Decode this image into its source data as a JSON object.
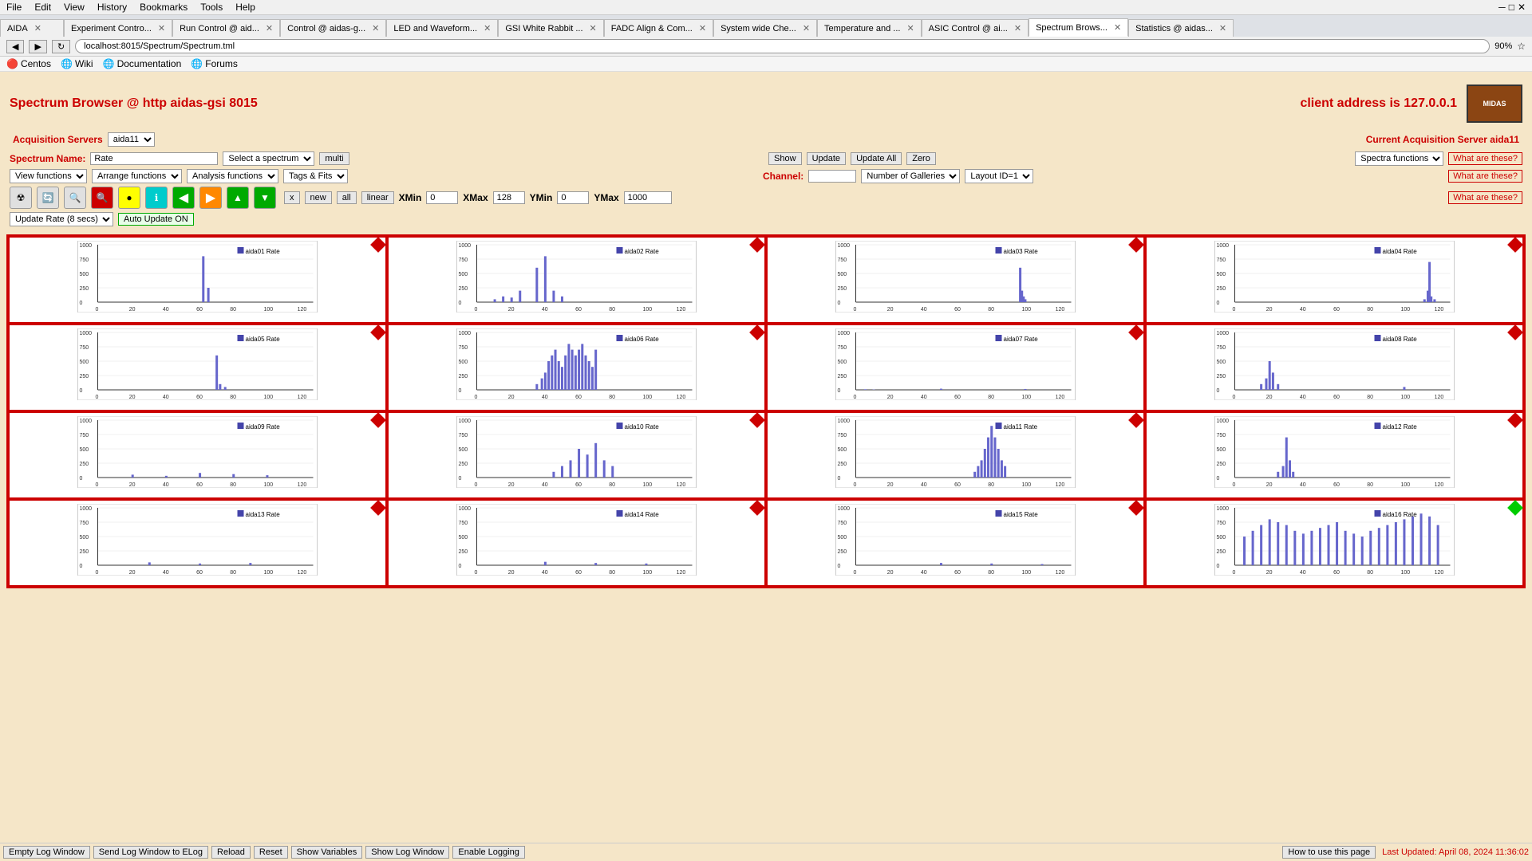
{
  "browser": {
    "menu_items": [
      "File",
      "Edit",
      "View",
      "History",
      "Bookmarks",
      "Tools",
      "Help"
    ],
    "tabs": [
      {
        "label": "AIDA",
        "active": false
      },
      {
        "label": "Experiment Contro...",
        "active": false
      },
      {
        "label": "Run Control @ aid...",
        "active": false
      },
      {
        "label": "Control @ aidas-g...",
        "active": false
      },
      {
        "label": "LED and Waveform...",
        "active": false
      },
      {
        "label": "GSI White Rabbit ...",
        "active": false
      },
      {
        "label": "FADC Align & Com...",
        "active": false
      },
      {
        "label": "System wide Che...",
        "active": false
      },
      {
        "label": "Temperature and ...",
        "active": false
      },
      {
        "label": "ASIC Control @ ai...",
        "active": false
      },
      {
        "label": "Spectrum Brows...",
        "active": true
      },
      {
        "label": "Statistics @ aidas...",
        "active": false
      }
    ],
    "address": "localhost:8015/Spectrum/Spectrum.tml",
    "zoom": "90%",
    "bookmarks": [
      {
        "label": "Centos"
      },
      {
        "label": "Wiki"
      },
      {
        "label": "Documentation"
      },
      {
        "label": "Forums"
      }
    ]
  },
  "page": {
    "title": "Spectrum Browser @ http aidas-gsi 8015",
    "client_address_label": "client address is 127.0.0.1",
    "acq_servers_label": "Acquisition Servers",
    "acq_server_value": "aida11",
    "current_server_label": "Current Acquisition Server aida11",
    "spectrum_name_label": "Spectrum Name:",
    "spectrum_name_value": "Rate",
    "select_spectrum_placeholder": "Select a spectrum",
    "multi_label": "multi",
    "show_label": "Show",
    "update_label": "Update",
    "update_all_label": "Update All",
    "zero_label": "Zero",
    "spectra_functions_label": "Spectra functions",
    "what_are_these_label": "What are these?",
    "view_functions_label": "View functions",
    "arrange_functions_label": "Arrange functions",
    "analysis_functions_label": "Analysis functions",
    "tags_fits_label": "Tags & Fits",
    "channel_label": "Channel:",
    "channel_value": "",
    "number_of_galleries_label": "Number of Galleries",
    "layout_id_label": "Layout ID=1",
    "x_label": "x",
    "new_label": "new",
    "all_label": "all",
    "linear_label": "linear",
    "xmin_label": "XMin",
    "xmin_value": "0",
    "xmax_label": "XMax",
    "xmax_value": "128",
    "ymin_label": "YMin",
    "ymin_value": "0",
    "ymax_label": "YMax",
    "ymax_value": "1000",
    "update_rate_label": "Update Rate (8 secs)",
    "auto_update_label": "Auto Update ON",
    "galleries": [
      {
        "id": 1,
        "label": "aida01 Rate",
        "diamond": "red"
      },
      {
        "id": 2,
        "label": "aida02 Rate",
        "diamond": "red"
      },
      {
        "id": 3,
        "label": "aida03 Rate",
        "diamond": "red"
      },
      {
        "id": 4,
        "label": "aida04 Rate",
        "diamond": "red"
      },
      {
        "id": 5,
        "label": "aida05 Rate",
        "diamond": "red"
      },
      {
        "id": 6,
        "label": "aida06 Rate",
        "diamond": "red"
      },
      {
        "id": 7,
        "label": "aida07 Rate",
        "diamond": "red"
      },
      {
        "id": 8,
        "label": "aida08 Rate",
        "diamond": "red"
      },
      {
        "id": 9,
        "label": "aida09 Rate",
        "diamond": "red"
      },
      {
        "id": 10,
        "label": "aida10 Rate",
        "diamond": "red"
      },
      {
        "id": 11,
        "label": "aida11 Rate",
        "diamond": "red"
      },
      {
        "id": 12,
        "label": "aida12 Rate",
        "diamond": "red"
      },
      {
        "id": 13,
        "label": "aida13 Rate",
        "diamond": "red"
      },
      {
        "id": 14,
        "label": "aida14 Rate",
        "diamond": "red"
      },
      {
        "id": 15,
        "label": "aida15 Rate",
        "diamond": "red"
      },
      {
        "id": 16,
        "label": "aida16 Rate",
        "diamond": "green"
      }
    ],
    "bottom_buttons": [
      "Empty Log Window",
      "Send Log Window to ELog",
      "Reload",
      "Reset",
      "Show Variables",
      "Show Log Window",
      "Enable Logging"
    ],
    "how_to_label": "How to use this page",
    "last_updated": "Last Updated: April 08, 2024 11:36:02"
  }
}
